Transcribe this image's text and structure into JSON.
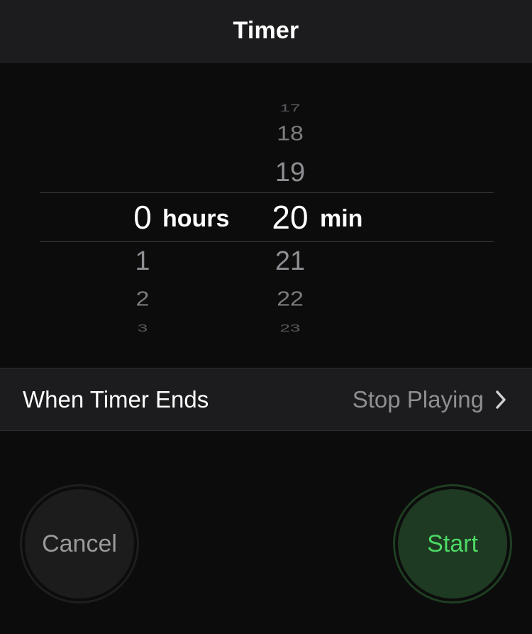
{
  "navbar": {
    "title": "Timer"
  },
  "picker": {
    "hours": {
      "above": [],
      "selected": "0",
      "below": [
        "1",
        "2",
        "3"
      ],
      "unit": "hours"
    },
    "minutes": {
      "above": [
        "17",
        "18",
        "19"
      ],
      "selected": "20",
      "below": [
        "21",
        "22",
        "23"
      ],
      "unit": "min"
    }
  },
  "when_timer_ends": {
    "label": "When Timer Ends",
    "value": "Stop Playing",
    "icon": "chevron-right-icon"
  },
  "buttons": {
    "cancel": "Cancel",
    "start": "Start"
  },
  "colors": {
    "accent_green": "#4cd964",
    "start_bg": "#1e3a22",
    "background": "#0c0c0c",
    "bar": "#1c1c1e"
  }
}
